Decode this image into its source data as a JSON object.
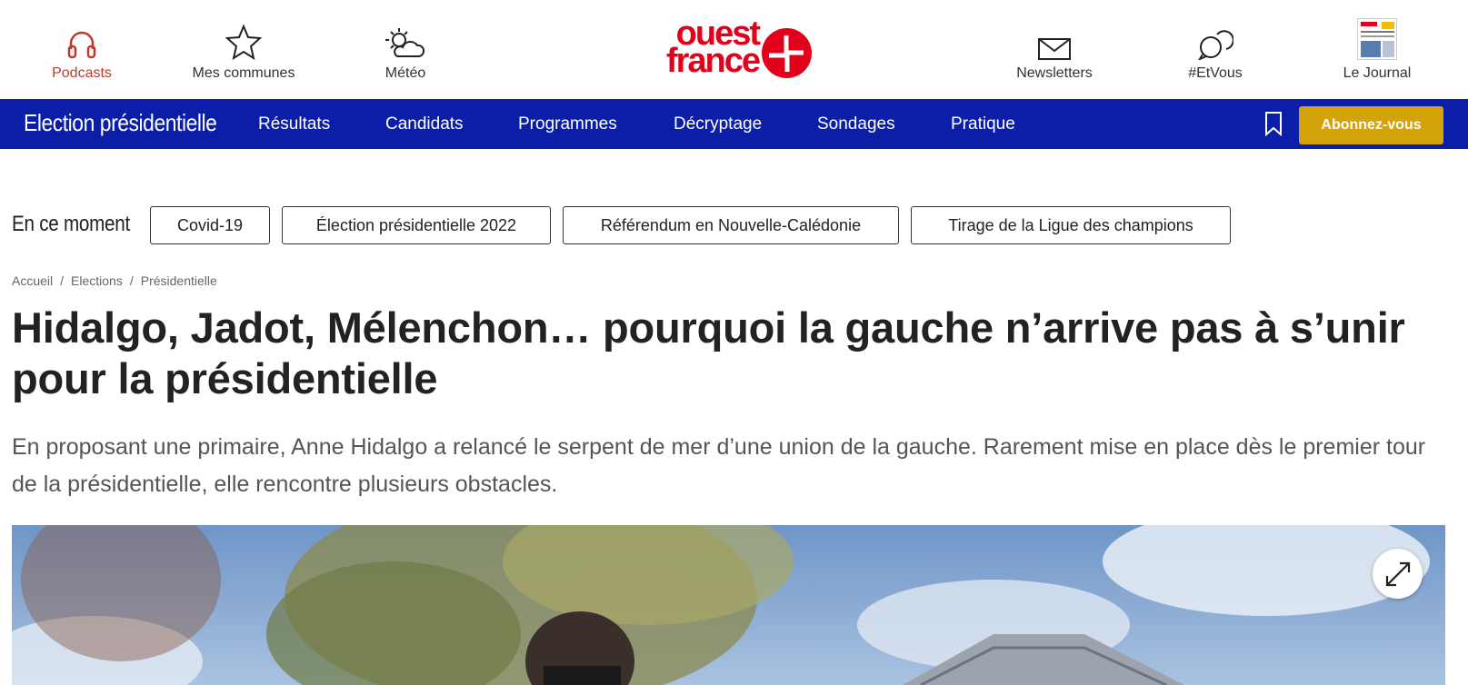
{
  "header": {
    "items": [
      {
        "label": "Podcasts",
        "icon": "headphones-icon"
      },
      {
        "label": "Mes communes",
        "icon": "star-icon"
      },
      {
        "label": "Météo",
        "icon": "weather-icon"
      },
      {
        "label": "Newsletters",
        "icon": "envelope-icon"
      },
      {
        "label": "#EtVous",
        "icon": "chat-bubbles-icon"
      },
      {
        "label": "Le Journal",
        "icon": "newspaper-thumbnail"
      }
    ],
    "logo": {
      "line1": "ouest",
      "line2": "france",
      "color": "#e2001a"
    }
  },
  "nav": {
    "title": "Election présidentielle",
    "links": [
      "Résultats",
      "Candidats",
      "Programmes",
      "Décryptage",
      "Sondages",
      "Pratique"
    ],
    "subscribe_label": "Abonnez-vous",
    "background": "#0b1ea7",
    "subscribe_color": "#d4a30a"
  },
  "moment": {
    "label": "En ce moment",
    "chips": [
      "Covid-19",
      "Élection présidentielle 2022",
      "Référendum en Nouvelle-Calédonie",
      "Tirage de la Ligue des champions"
    ]
  },
  "breadcrumb": [
    "Accueil",
    "Elections",
    "Présidentielle"
  ],
  "article": {
    "title": "Hidalgo, Jadot, Mélenchon… pourquoi la gauche n’arrive pas à s’unir pour la présidentielle",
    "lead": "En proposant une primaire, Anne Hidalgo a relancé le serpent de mer d’une union de la gauche. Rarement mise en place dès le premier tour de la présidentielle, elle rencontre plusieurs obstacles."
  }
}
